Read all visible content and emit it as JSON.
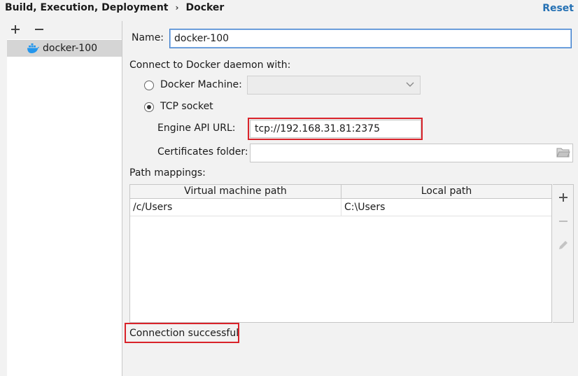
{
  "header": {
    "breadcrumb_parent": "Build, Execution, Deployment",
    "breadcrumb_separator": "›",
    "breadcrumb_current": "Docker",
    "reset_label": "Reset"
  },
  "sidebar": {
    "add_icon": "plus-icon",
    "remove_icon": "minus-icon",
    "items": [
      {
        "label": "docker-100",
        "icon": "docker-whale-icon",
        "selected": true
      }
    ]
  },
  "form": {
    "name_label": "Name:",
    "name_value": "docker-100",
    "connect_label": "Connect to Docker daemon with:",
    "docker_machine_label": "Docker Machine:",
    "docker_machine_selected": false,
    "docker_machine_value": "",
    "tcp_socket_label": "TCP socket",
    "tcp_socket_selected": true,
    "engine_api_url_label": "Engine API URL:",
    "engine_api_url_value": "tcp://192.168.31.81:2375",
    "certificates_folder_label": "Certificates folder:",
    "certificates_folder_value": "",
    "path_mappings_label": "Path mappings:"
  },
  "path_mappings": {
    "columns": [
      "Virtual machine path",
      "Local path"
    ],
    "rows": [
      {
        "vm_path": "/c/Users",
        "local_path": "C:\\Users"
      }
    ]
  },
  "status": {
    "message": "Connection successful"
  },
  "colors": {
    "accent": "#2470b3",
    "highlight_red": "#d9232a",
    "docker_blue": "#2496ed"
  }
}
